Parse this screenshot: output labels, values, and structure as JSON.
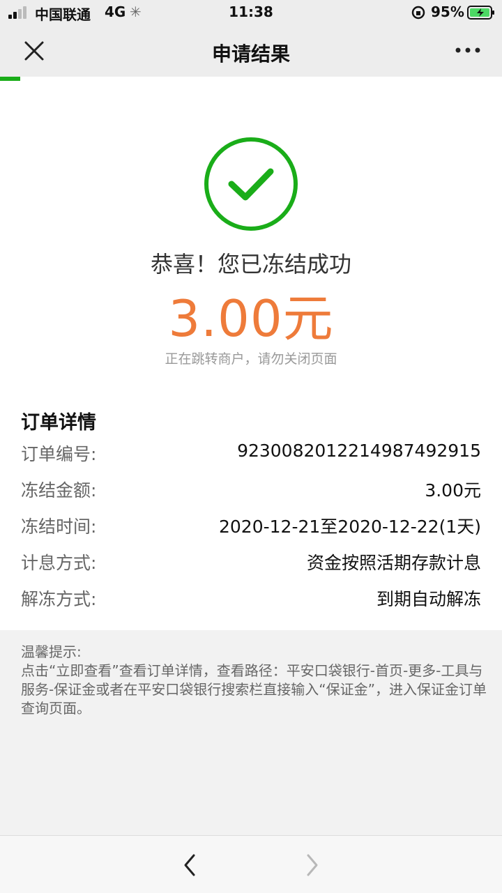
{
  "status_bar": {
    "carrier": "中国联通",
    "network": "4G",
    "time": "11:38",
    "battery": "95%"
  },
  "nav": {
    "title": "申请结果",
    "progress_fraction": 0.04
  },
  "result": {
    "title": "恭喜！您已冻结成功",
    "amount": "3.00元",
    "note": "正在跳转商户，请勿关闭页面"
  },
  "order": {
    "section_title": "订单详情",
    "rows": [
      {
        "label": "订单编号:",
        "value": "92300820122149874929​15"
      },
      {
        "label": "冻结金额:",
        "value": "3.00元"
      },
      {
        "label": "冻结时间:",
        "value": "2020-12-21至2020-12-22(1天)"
      },
      {
        "label": "计息方式:",
        "value": "资金按照活期存款计息"
      },
      {
        "label": "解冻方式:",
        "value": "到期自动解冻"
      }
    ]
  },
  "tips": {
    "heading": "温馨提示:",
    "body": "点击“立即查看”查看订单详情，查看路径：平安口袋银行-首页-更多-工具与服务-保证金或者在平安口袋银行搜索栏直接输入“保证金”，进入保证金订单查询页面。"
  },
  "colors": {
    "accent_green": "#1aad19",
    "success_green": "#1aad19",
    "amount_orange": "#ee7b3a"
  }
}
